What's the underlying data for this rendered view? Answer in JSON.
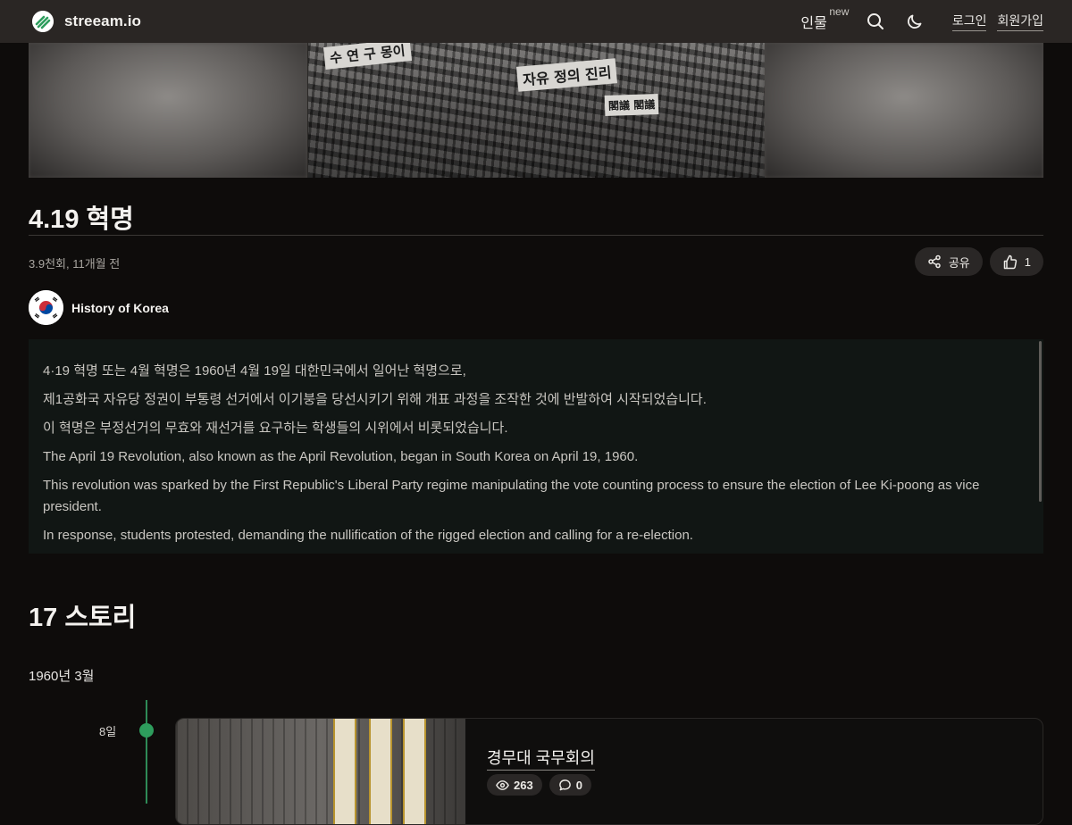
{
  "header": {
    "brand": "streeam.io",
    "nav_people": "인물",
    "nav_people_badge": "new",
    "login": "로그인",
    "signup": "회원가입",
    "icons": [
      "streeam-logo-icon",
      "search-icon",
      "moon-icon"
    ]
  },
  "hero": {
    "banner_left": "수 연 구 몽이",
    "banner_mid": "자유 정의 진리",
    "banner_right": "閣議 閣議"
  },
  "video": {
    "title": "4.19 혁명",
    "meta": "3.9천회, 11개월 전",
    "share_label": "공유",
    "like_count": "1",
    "channel_name": "History of Korea"
  },
  "description": {
    "lines": [
      "4·19 혁명 또는 4월 혁명은 1960년 4월 19일 대한민국에서 일어난 혁명으로,",
      "제1공화국 자유당 정권이 부통령 선거에서 이기붕을 당선시키기 위해 개표 과정을 조작한 것에 반발하여 시작되었습니다.",
      "이 혁명은 부정선거의 무효와 재선거를 요구하는 학생들의 시위에서 비롯되었습니다.",
      "The April 19 Revolution, also known as the April Revolution, began in South Korea on April 19, 1960.",
      "This revolution was sparked by the First Republic's Liberal Party regime manipulating the vote counting process to ensure the election of Lee Ki-poong as vice president.",
      "In response, students protested, demanding the nullification of the rigged election and calling for a re-election."
    ]
  },
  "stories": {
    "heading": "17 스토리",
    "month": "1960년 3월",
    "items": [
      {
        "day": "8일",
        "title": "경무대 국무회의",
        "views": "263",
        "comments": "0"
      }
    ]
  },
  "colors": {
    "header_bg": "#2a2624",
    "page_bg": "#0e0c0b",
    "accent_green": "#2e9d5d",
    "pill_bg": "#2a2726"
  }
}
